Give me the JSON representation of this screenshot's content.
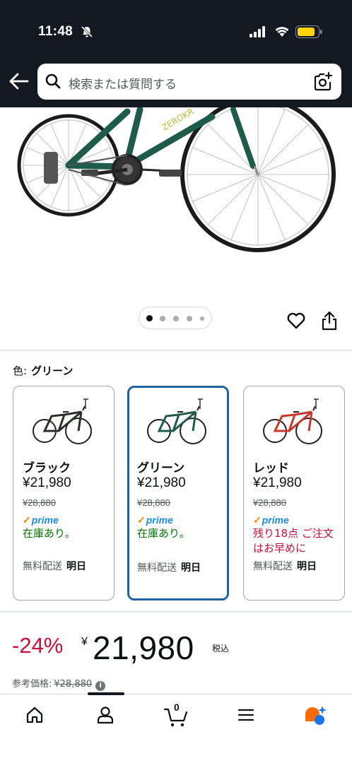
{
  "status_bar": {
    "time": "11:48"
  },
  "search": {
    "placeholder": "検索または質問する"
  },
  "gallery": {
    "image_count": 5,
    "active_index": 0
  },
  "variation": {
    "label": "色:",
    "selected_value": "グリーン",
    "options": [
      {
        "name": "ブラック",
        "price": "¥21,980",
        "list_price": "¥28,880",
        "prime": "prime",
        "stock": "在庫あり。",
        "delivery_label": "無料配送",
        "delivery_day": "明日",
        "frame_color": "#2b2f2a"
      },
      {
        "name": "グリーン",
        "price": "¥21,980",
        "list_price": "¥28,880",
        "prime": "prime",
        "stock": "在庫あり。",
        "delivery_label": "無料配送",
        "delivery_day": "明日",
        "frame_color": "#1f5b4a"
      },
      {
        "name": "レッド",
        "price": "¥21,980",
        "list_price": "¥28,880",
        "prime": "prime",
        "stock": "残り18点 ご注文はお早めに",
        "delivery_label": "無料配送",
        "delivery_day": "明日",
        "frame_color": "#c8382c"
      }
    ]
  },
  "price": {
    "discount": "-24%",
    "currency": "¥",
    "amount": "21,980",
    "tax_note": "税込",
    "reference_label": "参考価格:",
    "reference_price": "¥28,880"
  },
  "bottom_nav": {
    "items": [
      "home-icon",
      "account-icon",
      "cart-icon",
      "menu-icon",
      "rufus-icon"
    ],
    "cart_count": "0"
  },
  "colors": {
    "header": "#131921",
    "selected_border": "#2162a1",
    "deal_red": "#cc0c39",
    "stock_green": "#007600",
    "prime_blue": "#1a8bd6"
  }
}
